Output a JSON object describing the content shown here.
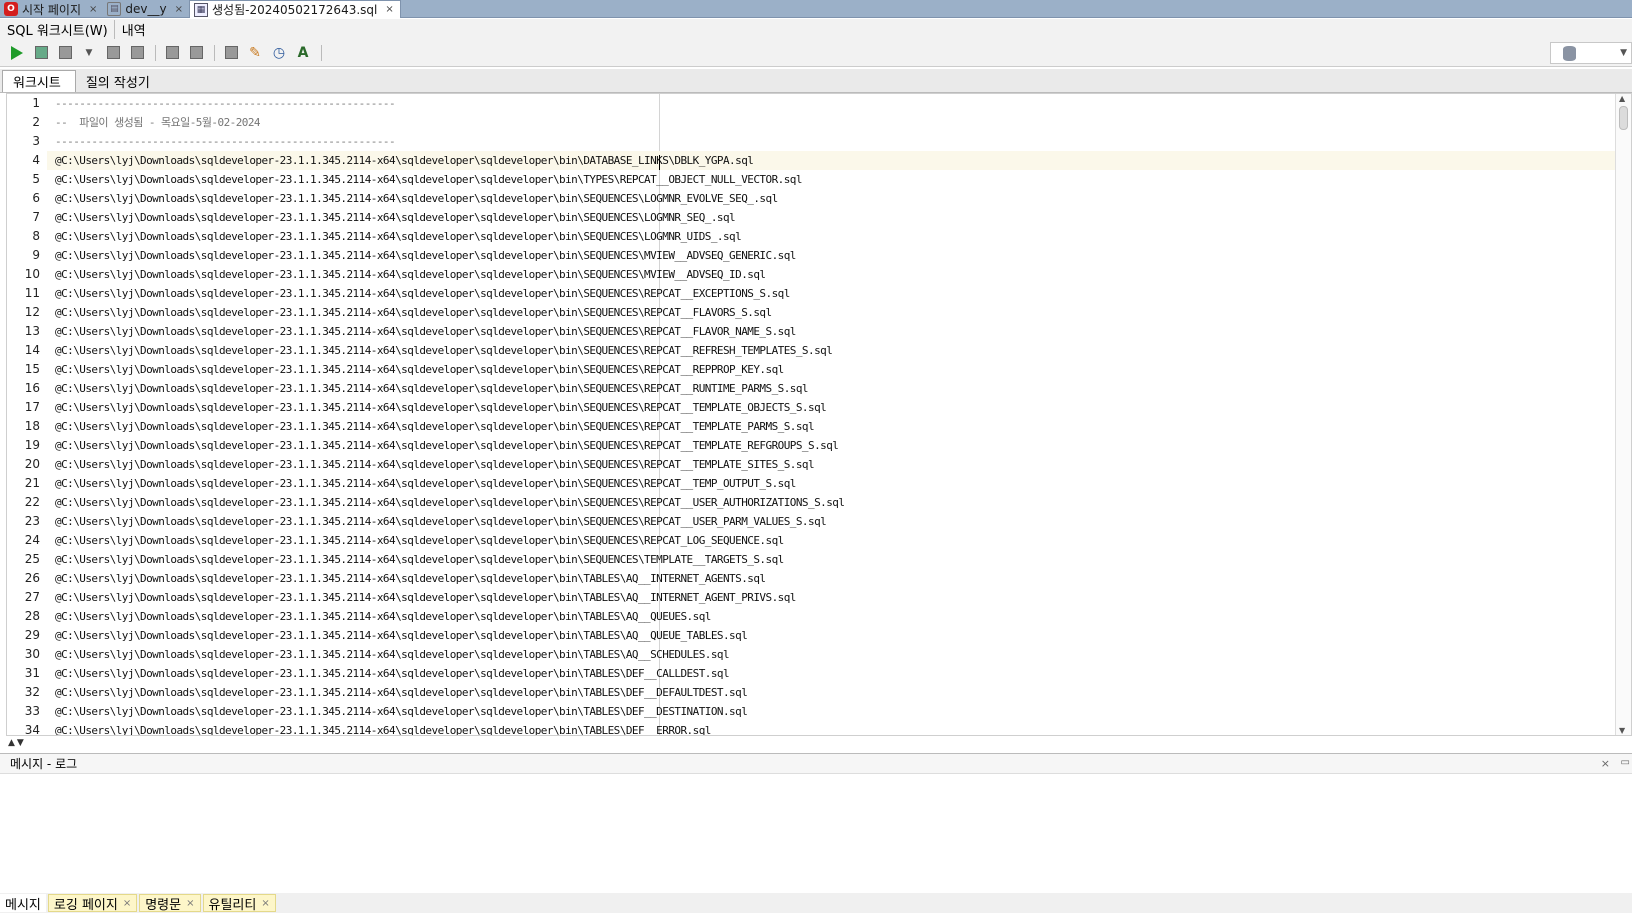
{
  "doc_tabs": [
    {
      "label": "시작 페이지",
      "close": "×",
      "icon": "oracle-icon"
    },
    {
      "label": "dev__y",
      "close": "×",
      "icon": "database-icon"
    },
    {
      "label": "생성됨-20240502172643.sql",
      "close": "×",
      "icon": "sql-file-icon"
    }
  ],
  "worksheet_menu": {
    "sql_worksheet": "SQL 워크시트(W)",
    "history": "내역"
  },
  "toolbar_icons": [
    "run-statement-icon",
    "run-script-icon",
    "autotrace-icon",
    "dropdown-icon",
    "commit-icon",
    "rollback-icon",
    "unshared-sql-icon",
    "explain-plan-icon",
    "sql-tuning-icon",
    "clear-icon",
    "history-icon",
    "format-icon"
  ],
  "sub_tabs": {
    "worksheet": "워크시트",
    "query_builder": "질의 작성기"
  },
  "editor": {
    "lines": [
      {
        "num": "1",
        "text": "--------------------------------------------------------",
        "comment": true
      },
      {
        "num": "2",
        "text": "--  파일이 생성됨 - 목요일-5월-02-2024",
        "comment": true
      },
      {
        "num": "3",
        "text": "--------------------------------------------------------",
        "comment": true
      },
      {
        "num": "4",
        "text": "@C:\\Users\\lyj\\Downloads\\sqldeveloper-23.1.1.345.2114-x64\\sqldeveloper\\sqldeveloper\\bin\\DATABASE_LINKS\\DBLK_YGPA.sql",
        "current": true
      },
      {
        "num": "5",
        "text": "@C:\\Users\\lyj\\Downloads\\sqldeveloper-23.1.1.345.2114-x64\\sqldeveloper\\sqldeveloper\\bin\\TYPES\\REPCAT__OBJECT_NULL_VECTOR.sql"
      },
      {
        "num": "6",
        "text": "@C:\\Users\\lyj\\Downloads\\sqldeveloper-23.1.1.345.2114-x64\\sqldeveloper\\sqldeveloper\\bin\\SEQUENCES\\LOGMNR_EVOLVE_SEQ_.sql"
      },
      {
        "num": "7",
        "text": "@C:\\Users\\lyj\\Downloads\\sqldeveloper-23.1.1.345.2114-x64\\sqldeveloper\\sqldeveloper\\bin\\SEQUENCES\\LOGMNR_SEQ_.sql"
      },
      {
        "num": "8",
        "text": "@C:\\Users\\lyj\\Downloads\\sqldeveloper-23.1.1.345.2114-x64\\sqldeveloper\\sqldeveloper\\bin\\SEQUENCES\\LOGMNR_UIDS_.sql"
      },
      {
        "num": "9",
        "text": "@C:\\Users\\lyj\\Downloads\\sqldeveloper-23.1.1.345.2114-x64\\sqldeveloper\\sqldeveloper\\bin\\SEQUENCES\\MVIEW__ADVSEQ_GENERIC.sql"
      },
      {
        "num": "10",
        "text": "@C:\\Users\\lyj\\Downloads\\sqldeveloper-23.1.1.345.2114-x64\\sqldeveloper\\sqldeveloper\\bin\\SEQUENCES\\MVIEW__ADVSEQ_ID.sql"
      },
      {
        "num": "11",
        "text": "@C:\\Users\\lyj\\Downloads\\sqldeveloper-23.1.1.345.2114-x64\\sqldeveloper\\sqldeveloper\\bin\\SEQUENCES\\REPCAT__EXCEPTIONS_S.sql"
      },
      {
        "num": "12",
        "text": "@C:\\Users\\lyj\\Downloads\\sqldeveloper-23.1.1.345.2114-x64\\sqldeveloper\\sqldeveloper\\bin\\SEQUENCES\\REPCAT__FLAVORS_S.sql"
      },
      {
        "num": "13",
        "text": "@C:\\Users\\lyj\\Downloads\\sqldeveloper-23.1.1.345.2114-x64\\sqldeveloper\\sqldeveloper\\bin\\SEQUENCES\\REPCAT__FLAVOR_NAME_S.sql"
      },
      {
        "num": "14",
        "text": "@C:\\Users\\lyj\\Downloads\\sqldeveloper-23.1.1.345.2114-x64\\sqldeveloper\\sqldeveloper\\bin\\SEQUENCES\\REPCAT__REFRESH_TEMPLATES_S.sql"
      },
      {
        "num": "15",
        "text": "@C:\\Users\\lyj\\Downloads\\sqldeveloper-23.1.1.345.2114-x64\\sqldeveloper\\sqldeveloper\\bin\\SEQUENCES\\REPCAT__REPPROP_KEY.sql"
      },
      {
        "num": "16",
        "text": "@C:\\Users\\lyj\\Downloads\\sqldeveloper-23.1.1.345.2114-x64\\sqldeveloper\\sqldeveloper\\bin\\SEQUENCES\\REPCAT__RUNTIME_PARMS_S.sql"
      },
      {
        "num": "17",
        "text": "@C:\\Users\\lyj\\Downloads\\sqldeveloper-23.1.1.345.2114-x64\\sqldeveloper\\sqldeveloper\\bin\\SEQUENCES\\REPCAT__TEMPLATE_OBJECTS_S.sql"
      },
      {
        "num": "18",
        "text": "@C:\\Users\\lyj\\Downloads\\sqldeveloper-23.1.1.345.2114-x64\\sqldeveloper\\sqldeveloper\\bin\\SEQUENCES\\REPCAT__TEMPLATE_PARMS_S.sql"
      },
      {
        "num": "19",
        "text": "@C:\\Users\\lyj\\Downloads\\sqldeveloper-23.1.1.345.2114-x64\\sqldeveloper\\sqldeveloper\\bin\\SEQUENCES\\REPCAT__TEMPLATE_REFGROUPS_S.sql"
      },
      {
        "num": "20",
        "text": "@C:\\Users\\lyj\\Downloads\\sqldeveloper-23.1.1.345.2114-x64\\sqldeveloper\\sqldeveloper\\bin\\SEQUENCES\\REPCAT__TEMPLATE_SITES_S.sql"
      },
      {
        "num": "21",
        "text": "@C:\\Users\\lyj\\Downloads\\sqldeveloper-23.1.1.345.2114-x64\\sqldeveloper\\sqldeveloper\\bin\\SEQUENCES\\REPCAT__TEMP_OUTPUT_S.sql"
      },
      {
        "num": "22",
        "text": "@C:\\Users\\lyj\\Downloads\\sqldeveloper-23.1.1.345.2114-x64\\sqldeveloper\\sqldeveloper\\bin\\SEQUENCES\\REPCAT__USER_AUTHORIZATIONS_S.sql"
      },
      {
        "num": "23",
        "text": "@C:\\Users\\lyj\\Downloads\\sqldeveloper-23.1.1.345.2114-x64\\sqldeveloper\\sqldeveloper\\bin\\SEQUENCES\\REPCAT__USER_PARM_VALUES_S.sql"
      },
      {
        "num": "24",
        "text": "@C:\\Users\\lyj\\Downloads\\sqldeveloper-23.1.1.345.2114-x64\\sqldeveloper\\sqldeveloper\\bin\\SEQUENCES\\REPCAT_LOG_SEQUENCE.sql"
      },
      {
        "num": "25",
        "text": "@C:\\Users\\lyj\\Downloads\\sqldeveloper-23.1.1.345.2114-x64\\sqldeveloper\\sqldeveloper\\bin\\SEQUENCES\\TEMPLATE__TARGETS_S.sql"
      },
      {
        "num": "26",
        "text": "@C:\\Users\\lyj\\Downloads\\sqldeveloper-23.1.1.345.2114-x64\\sqldeveloper\\sqldeveloper\\bin\\TABLES\\AQ__INTERNET_AGENTS.sql"
      },
      {
        "num": "27",
        "text": "@C:\\Users\\lyj\\Downloads\\sqldeveloper-23.1.1.345.2114-x64\\sqldeveloper\\sqldeveloper\\bin\\TABLES\\AQ__INTERNET_AGENT_PRIVS.sql"
      },
      {
        "num": "28",
        "text": "@C:\\Users\\lyj\\Downloads\\sqldeveloper-23.1.1.345.2114-x64\\sqldeveloper\\sqldeveloper\\bin\\TABLES\\AQ__QUEUES.sql"
      },
      {
        "num": "29",
        "text": "@C:\\Users\\lyj\\Downloads\\sqldeveloper-23.1.1.345.2114-x64\\sqldeveloper\\sqldeveloper\\bin\\TABLES\\AQ__QUEUE_TABLES.sql"
      },
      {
        "num": "30",
        "text": "@C:\\Users\\lyj\\Downloads\\sqldeveloper-23.1.1.345.2114-x64\\sqldeveloper\\sqldeveloper\\bin\\TABLES\\AQ__SCHEDULES.sql"
      },
      {
        "num": "31",
        "text": "@C:\\Users\\lyj\\Downloads\\sqldeveloper-23.1.1.345.2114-x64\\sqldeveloper\\sqldeveloper\\bin\\TABLES\\DEF__CALLDEST.sql"
      },
      {
        "num": "32",
        "text": "@C:\\Users\\lyj\\Downloads\\sqldeveloper-23.1.1.345.2114-x64\\sqldeveloper\\sqldeveloper\\bin\\TABLES\\DEF__DEFAULTDEST.sql"
      },
      {
        "num": "33",
        "text": "@C:\\Users\\lyj\\Downloads\\sqldeveloper-23.1.1.345.2114-x64\\sqldeveloper\\sqldeveloper\\bin\\TABLES\\DEF__DESTINATION.sql"
      },
      {
        "num": "34",
        "text": "@C:\\Users\\lyj\\Downloads\\sqldeveloper-23.1.1.345.2114-x64\\sqldeveloper\\sqldeveloper\\bin\\TABLES\\DEF__ERROR.sql"
      }
    ]
  },
  "message_log": {
    "title": "메시지 - 로그",
    "close": "×"
  },
  "bottom_tabs": [
    {
      "label": "메시지",
      "active": true
    },
    {
      "label": "로깅 페이지",
      "close": "×"
    },
    {
      "label": "명령문",
      "close": "×"
    },
    {
      "label": "유틸리티",
      "close": "×"
    }
  ],
  "colors": {
    "tab_bar": "#9bb0c8",
    "current_line": "#fbf8ea",
    "run_green": "#1f9b2a",
    "bottom_tab_highlight": "#fdf6c9"
  }
}
